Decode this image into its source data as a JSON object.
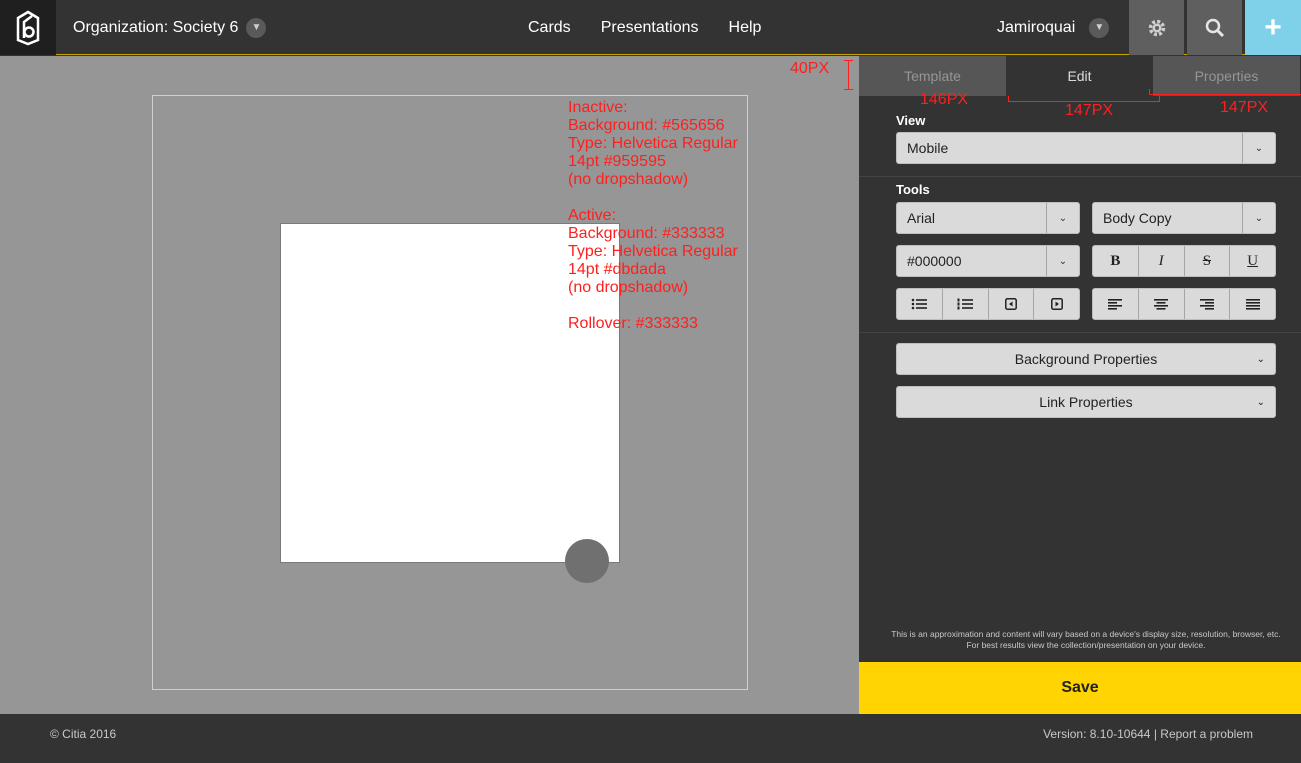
{
  "header": {
    "organization_label": "Organization: Society 6",
    "nav": [
      "Cards",
      "Presentations",
      "Help"
    ],
    "user": "Jamiroquai",
    "icons": {
      "logo": "citia-logo",
      "settings": "gear-icon",
      "search": "search-icon",
      "add": "plus-icon"
    },
    "accent_add": "#7fd1ea"
  },
  "canvas": {
    "annotation": "Inactive:\nBackground: #565656\nType: Helvetica Regular\n14pt #959595\n(no dropshadow)\n\nActive:\nBackground: #333333\nType: Helvetica Regular\n14pt #dbdada\n(no dropshadow)\n\nRollover: #333333",
    "dim_height": "40PX"
  },
  "panel": {
    "tabs": [
      "Template",
      "Edit",
      "Properties"
    ],
    "active_tab": "Edit",
    "dims": [
      "146PX",
      "147PX",
      "147PX"
    ],
    "view_label": "View",
    "view_value": "Mobile",
    "tools_label": "Tools",
    "font_value": "Arial",
    "style_value": "Body Copy",
    "color_value": "#000000",
    "format_buttons": [
      "B",
      "I",
      "S",
      "U"
    ],
    "list_buttons": [
      "bullet-list-icon",
      "numbered-list-icon",
      "outdent-icon",
      "indent-icon"
    ],
    "align_buttons": [
      "align-left-icon",
      "align-center-icon",
      "align-right-icon",
      "align-justify-icon"
    ],
    "background_properties": "Background Properties",
    "link_properties": "Link Properties",
    "disclaimer": "This is an approximation and content will vary based on a device's display size, resolution, browser, etc. For best results view the collection/presentation on your device.",
    "save": "Save"
  },
  "footer": {
    "copyright": "© Citia 2016",
    "version": "Version: 8.10-10644",
    "separator": " | ",
    "report": "Report a problem"
  }
}
